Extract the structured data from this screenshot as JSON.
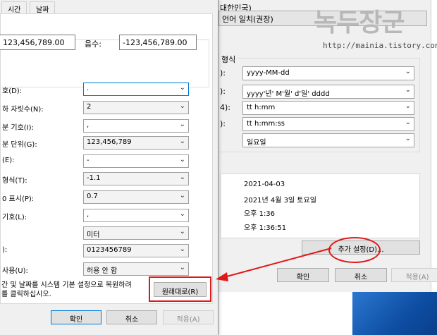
{
  "back_window": {
    "region": "대한민국)",
    "language_combo": "언어 일치(권장)",
    "formats_title": "형식",
    "format_rows": [
      {
        "label": "):",
        "value": "yyyy-MM-dd"
      },
      {
        "label": "):",
        "value": "yyyy'년' M'월' d'일' dddd"
      },
      {
        "label": "4):",
        "value": "tt h:mm"
      },
      {
        "label": "):",
        "value": "tt h:mm:ss"
      },
      {
        "label": "",
        "value": "일요일"
      }
    ],
    "examples": [
      "2021-04-03",
      "2021년 4월 3일 토요일",
      "오후 1:36",
      "오후 1:36:51"
    ],
    "additional_settings_button": "추가 설정(D)...",
    "ok_button": "확인",
    "cancel_button": "취소",
    "apply_button": "적용(A)"
  },
  "watermark": {
    "title": "녹두장군",
    "url": "http://mainia.tistory.com"
  },
  "front_dialog": {
    "tabs": [
      "시간",
      "날짜"
    ],
    "positive_example": "123,456,789.00",
    "negative_label": "음수:",
    "negative_example": "-123,456,789.00",
    "rows": [
      {
        "label": "호(D):",
        "value": "."
      },
      {
        "label": "하 자릿수(N):",
        "value": "2"
      },
      {
        "label": "분 기호(I):",
        "value": ","
      },
      {
        "label": "분 단위(G):",
        "value": "123,456,789"
      },
      {
        "label": "(E):",
        "value": "-"
      },
      {
        "label": "형식(T):",
        "value": "-1.1"
      },
      {
        "label": "0 표시(P):",
        "value": "0.7"
      },
      {
        "label": "기호(L):",
        "value": ","
      },
      {
        "label": "",
        "value": "미터"
      },
      {
        "label": "):",
        "value": "0123456789"
      },
      {
        "label": "사용(U):",
        "value": "허용 안 함"
      }
    ],
    "restore_text_line1": "간 및 날짜를 시스템 기본 설정으로 복원하려",
    "restore_text_line2": "를 클릭하십시오.",
    "restore_button": "원래대로(R)",
    "ok_button": "확인",
    "cancel_button": "취소",
    "apply_button": "적용(A)"
  },
  "colors": {
    "annotation_red": "#e01818",
    "taskbar_blue": "#1a5fb4",
    "focus_blue": "#0078d7"
  }
}
